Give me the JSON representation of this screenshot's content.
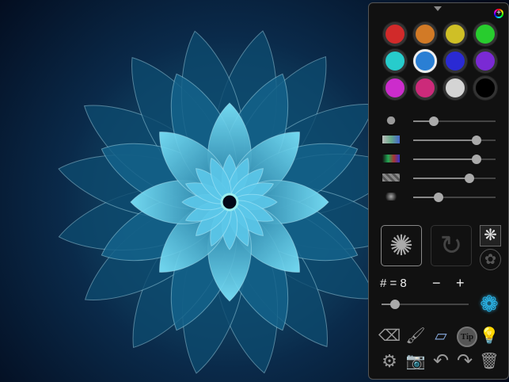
{
  "colors": {
    "accent": "#2a7fd4",
    "panel_bg": "#111111"
  },
  "palette": {
    "swatches": [
      "#d12a2a",
      "#d27a26",
      "#cfbf26",
      "#28cc2e",
      "#27cccc",
      "#2a7fd4",
      "#2a2ad4",
      "#7a2ad4",
      "#cc2ccc",
      "#cc2a7a",
      "#d4d4d4",
      "#000000"
    ],
    "selected_index": 5
  },
  "sliders": [
    {
      "name": "brush-size",
      "icon": "size-dots-icon",
      "value": 0.25
    },
    {
      "name": "gradient",
      "icon": "gradient-icon",
      "value": 0.77
    },
    {
      "name": "color-variation",
      "icon": "rgb-gradient-icon",
      "value": 0.77
    },
    {
      "name": "opacity",
      "icon": "transparency-icon",
      "value": 0.68
    },
    {
      "name": "softness",
      "icon": "blur-dots-icon",
      "value": 0.31
    }
  ],
  "symmetry": {
    "label": "# = 8",
    "minus": "−",
    "plus": "+",
    "value": 0.15
  },
  "tools": {
    "tip_label": "Tip"
  }
}
